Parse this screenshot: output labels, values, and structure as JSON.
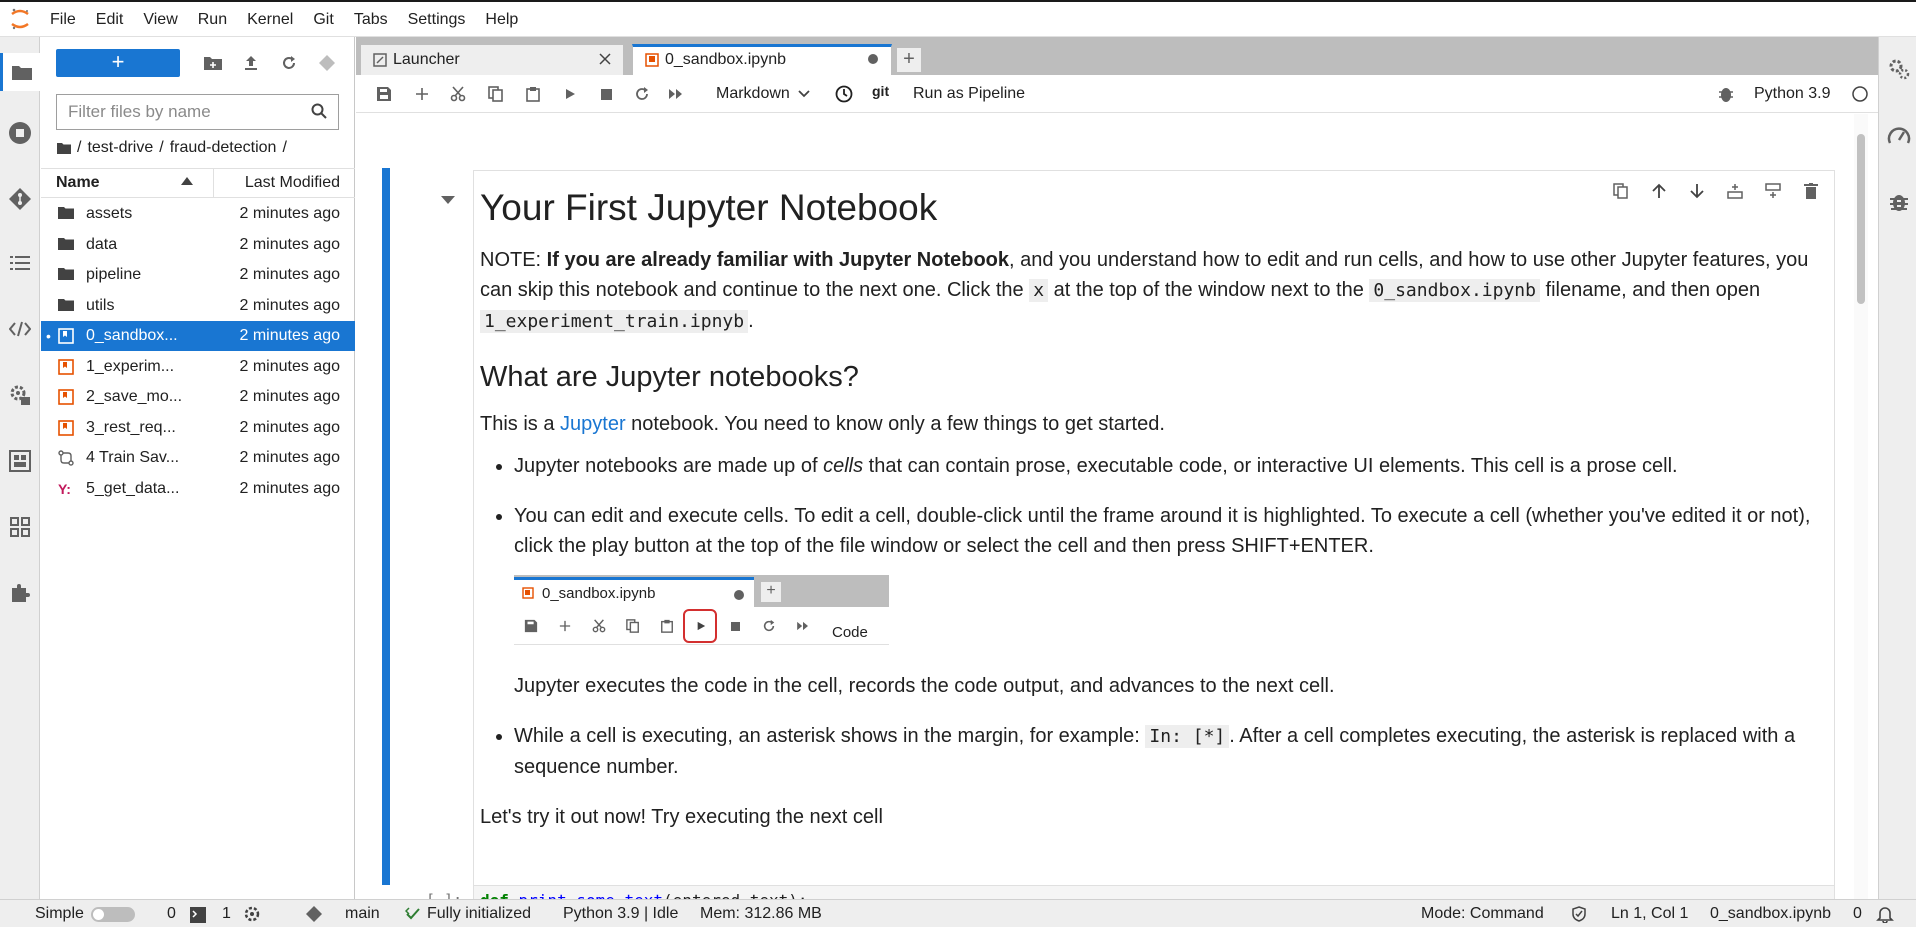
{
  "menu": [
    "File",
    "Edit",
    "View",
    "Run",
    "Kernel",
    "Git",
    "Tabs",
    "Settings",
    "Help"
  ],
  "filebrowser": {
    "new_label": "+",
    "filter_placeholder": "Filter files by name",
    "breadcrumb": [
      "/",
      "test-drive",
      "/",
      "fraud-detection",
      "/"
    ],
    "col_name": "Name",
    "col_modified": "Last Modified",
    "files": [
      {
        "name": "assets",
        "modified": "2 minutes ago",
        "icon": "folder-icon"
      },
      {
        "name": "data",
        "modified": "2 minutes ago",
        "icon": "folder-icon"
      },
      {
        "name": "pipeline",
        "modified": "2 minutes ago",
        "icon": "folder-icon"
      },
      {
        "name": "utils",
        "modified": "2 minutes ago",
        "icon": "folder-icon"
      },
      {
        "name": "0_sandbox...",
        "modified": "2 minutes ago",
        "icon": "notebook-icon",
        "selected": true,
        "open": "•"
      },
      {
        "name": "1_experim...",
        "modified": "2 minutes ago",
        "icon": "notebook-icon"
      },
      {
        "name": "2_save_mo...",
        "modified": "2 minutes ago",
        "icon": "notebook-icon"
      },
      {
        "name": "3_rest_req...",
        "modified": "2 minutes ago",
        "icon": "notebook-icon"
      },
      {
        "name": "4 Train Sav...",
        "modified": "2 minutes ago",
        "icon": "pipeline-icon"
      },
      {
        "name": "5_get_data...",
        "modified": "2 minutes ago",
        "icon": "yaml-icon"
      }
    ]
  },
  "tabs": [
    {
      "label": "Launcher",
      "active": false
    },
    {
      "label": "0_sandbox.ipynb",
      "active": true
    }
  ],
  "toolbar": {
    "cell_type": "Markdown",
    "git_label": "git",
    "run_pipeline": "Run as Pipeline",
    "kernel": "Python 3.9"
  },
  "notebook": {
    "h1": "Your First Jupyter Notebook",
    "note_prefix": "NOTE: ",
    "note_bold": "If you are already familiar with Jupyter Notebook",
    "note_rest1": ", and you understand how to edit and run cells, and how to use other Jupyter features, you can skip this notebook and continue to the next one. Click the ",
    "note_code1": "x",
    "note_rest2": " at the top of the window next to the ",
    "note_code2": "0_sandbox.ipynb",
    "note_rest3": " filename, and then open ",
    "note_code3": "1_experiment_train.ipnyb",
    "note_rest4": ".",
    "h2": "What are Jupyter notebooks?",
    "intro_prefix": "This is a ",
    "intro_link": "Jupyter",
    "intro_rest": " notebook. You need to know only a few things to get started.",
    "bullet1_prefix": "Jupyter notebooks are made up of ",
    "bullet1_em": "cells",
    "bullet1_rest": " that can contain prose, executable code, or interactive UI elements. This cell is a prose cell.",
    "bullet2": "You can edit and execute cells. To edit a cell, double-click until the frame around it is highlighted. To execute a cell (whether you've edited it or not), click the play button at the top of the file window or select the cell and then press SHIFT+ENTER.",
    "shot_tab": "0_sandbox.ipynb",
    "shot_plus": "+",
    "shot_code": "Code",
    "bullet2_after": "Jupyter executes the code in the cell, records the code output, and advances to the next cell.",
    "bullet3_prefix": "While a cell is executing, an asterisk shows in the margin, for example: ",
    "bullet3_code": "In: [*]",
    "bullet3_rest": ". After a cell completes executing, the asterisk is replaced with a sequence number.",
    "closing": "Let's try it out now! Try executing the next cell",
    "code_prompt": "[ ]:",
    "code_kw": "def",
    "code_fn": "print_some_text",
    "code_rest": "(entered_text):"
  },
  "status": {
    "mode_simple": "Simple",
    "count0": "0",
    "count1": "1",
    "branch": "main",
    "initialized": "Fully initialized",
    "kernel_state": "Python 3.9 | Idle",
    "mem": "Mem: 312.86 MB",
    "mode": "Mode: Command",
    "position": "Ln 1, Col 1",
    "filename": "0_sandbox.ipynb",
    "notif_count": "0"
  },
  "colors": {
    "accent": "#1976d2",
    "notebook_orange": "#e65100",
    "highlight_red": "#d32f2f"
  }
}
